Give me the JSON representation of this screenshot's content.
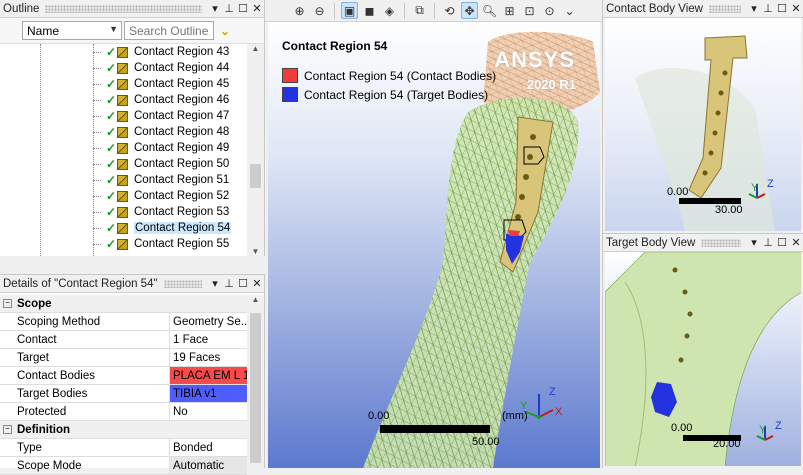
{
  "outline": {
    "title": "Outline",
    "column_combo": "Name",
    "search_placeholder": "Search Outline",
    "items": [
      {
        "label": "Contact Region 43"
      },
      {
        "label": "Contact Region 44"
      },
      {
        "label": "Contact Region 45"
      },
      {
        "label": "Contact Region 46"
      },
      {
        "label": "Contact Region 47"
      },
      {
        "label": "Contact Region 48"
      },
      {
        "label": "Contact Region 49"
      },
      {
        "label": "Contact Region 50"
      },
      {
        "label": "Contact Region 51"
      },
      {
        "label": "Contact Region 52"
      },
      {
        "label": "Contact Region 53"
      },
      {
        "label": "Contact Region 54"
      },
      {
        "label": "Contact Region 55"
      }
    ],
    "selected_index": 11
  },
  "details": {
    "title": "Details of \"Contact Region 54\"",
    "sections": {
      "scope": "Scope",
      "definition": "Definition"
    },
    "props": {
      "scoping_method": {
        "key": "Scoping Method",
        "value": "Geometry Se..."
      },
      "contact": {
        "key": "Contact",
        "value": "1 Face"
      },
      "target": {
        "key": "Target",
        "value": "19 Faces"
      },
      "contact_bodies": {
        "key": "Contact Bodies",
        "value": "PLACA EM L 1"
      },
      "target_bodies": {
        "key": "Target Bodies",
        "value": "TIBIA v1"
      },
      "protected": {
        "key": "Protected",
        "value": "No"
      },
      "type": {
        "key": "Type",
        "value": "Bonded"
      },
      "scope_mode": {
        "key": "Scope Mode",
        "value": "Automatic"
      }
    },
    "colors": {
      "contact": "#f74b4b",
      "target": "#4f5dff"
    }
  },
  "viewport": {
    "title": "Contact Region 54",
    "legend": [
      {
        "label": "Contact Region 54 (Contact Bodies)",
        "color": "#ef3b3b"
      },
      {
        "label": "Contact Region 54 (Target Bodies)",
        "color": "#2333e0"
      }
    ],
    "brand": "ANSYS",
    "version": "2020 R1",
    "scale": {
      "min": "0.00",
      "max": "50.00",
      "unit": "(mm)"
    }
  },
  "contact_body_view": {
    "title": "Contact Body View",
    "scale": {
      "min": "0.00",
      "max": "30.00"
    }
  },
  "target_body_view": {
    "title": "Target Body View",
    "scale": {
      "min": "0.00",
      "max": "20.00"
    }
  },
  "axis": {
    "x": "X",
    "y": "Y",
    "z": "Z"
  },
  "window_controls": {
    "menu": "▾",
    "pin": "⊥",
    "restore": "☐",
    "close": "✕"
  }
}
